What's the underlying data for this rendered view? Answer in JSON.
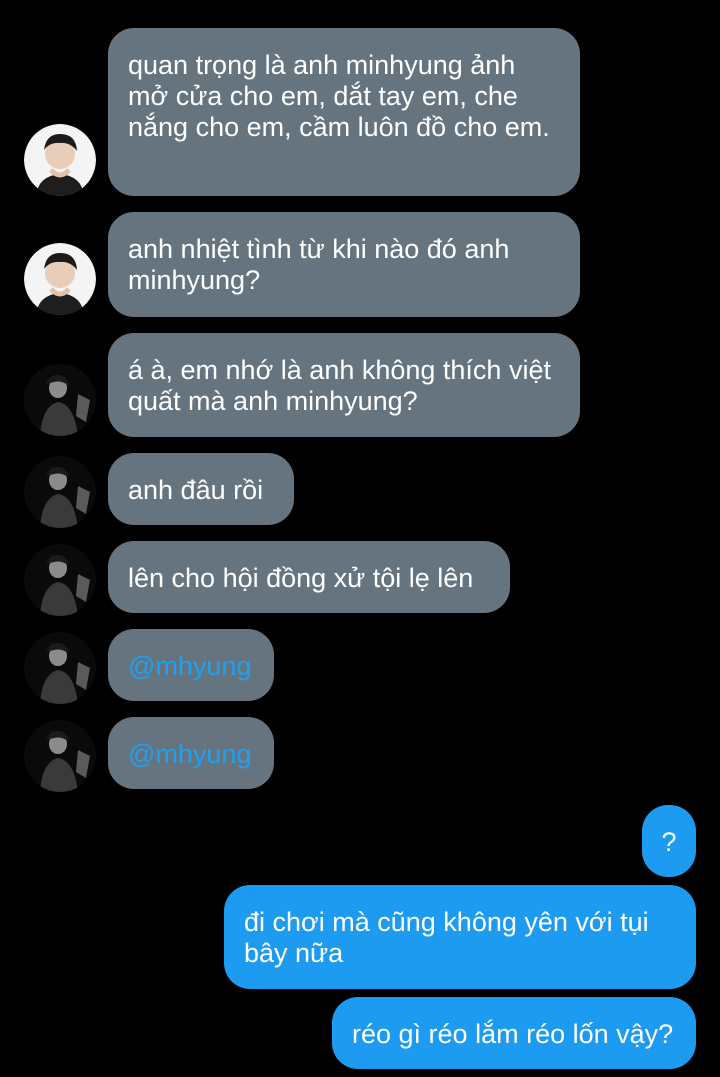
{
  "conversation": {
    "messages": [
      {
        "side": "incoming",
        "sender": "light",
        "text": "quan trọng là anh minhyung ảnh mở cửa cho em, dắt tay em, che nắng cho em, cầm luôn đồ cho em."
      },
      {
        "side": "incoming",
        "sender": "light",
        "text": "anh nhiệt tình từ khi nào đó anh minhyung?"
      },
      {
        "side": "incoming",
        "sender": "dark",
        "text": "á à, em nhớ là anh không thích việt quất mà anh minhyung?"
      },
      {
        "side": "incoming",
        "sender": "dark",
        "text": "anh đâu rồi"
      },
      {
        "side": "incoming",
        "sender": "dark",
        "text": "lên cho hội đồng xử tội lẹ lên"
      },
      {
        "side": "incoming",
        "sender": "dark",
        "text": "@mhyung",
        "mention": true
      },
      {
        "side": "incoming",
        "sender": "dark",
        "text": "@mhyung",
        "mention": true
      },
      {
        "side": "outgoing",
        "text": "?"
      },
      {
        "side": "outgoing",
        "text": "đi chơi mà cũng không yên với tụi bây nữa"
      },
      {
        "side": "outgoing",
        "text": "réo gì réo lắm réo lốn vậy?"
      }
    ]
  },
  "colors": {
    "background": "#000000",
    "incoming_bubble": "#66747f",
    "outgoing_bubble": "#1c9bf0",
    "mention": "#1da1f2",
    "text": "#ffffff"
  }
}
